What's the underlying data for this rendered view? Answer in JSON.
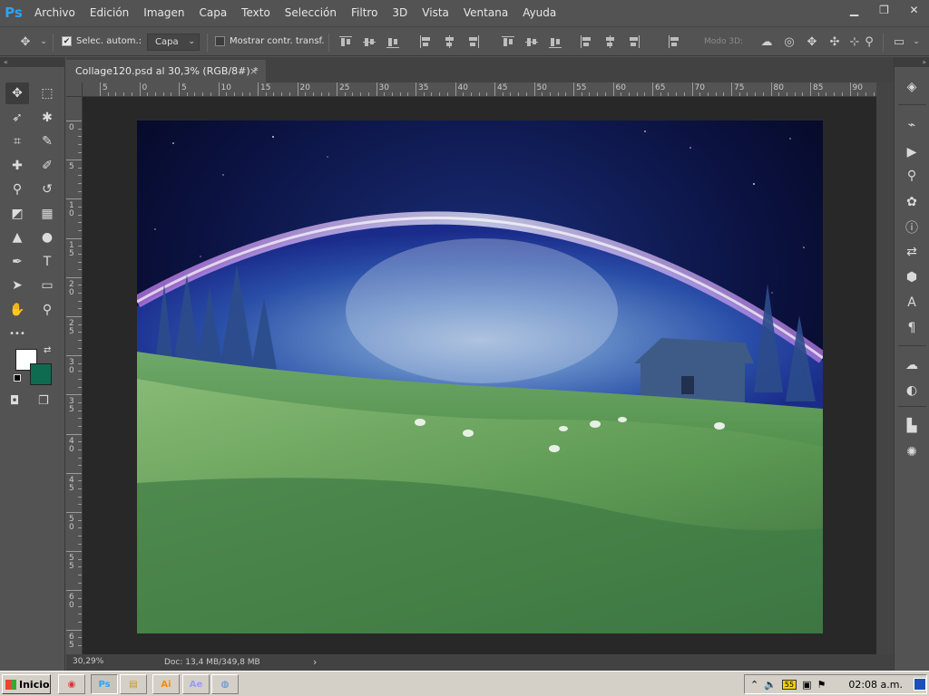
{
  "app": {
    "logo": "Ps"
  },
  "menu": [
    "Archivo",
    "Edición",
    "Imagen",
    "Capa",
    "Texto",
    "Selección",
    "Filtro",
    "3D",
    "Vista",
    "Ventana",
    "Ayuda"
  ],
  "window_controls": {
    "minimize": "▁",
    "restore": "❐",
    "close": "✕"
  },
  "options": {
    "auto_select_label": "Selec. autom.:",
    "auto_select_checked": true,
    "layer_select_value": "Capa",
    "show_transform_label": "Mostrar contr. transf.",
    "show_transform_checked": false,
    "mode3d_label": "Modo 3D:"
  },
  "document": {
    "tab_title": "Collage120.psd al 30,3% (RGB/8#) *",
    "close_glyph": "×",
    "zoom": "30,29%",
    "doc_info": "Doc: 13,4 MB/349,8 MB"
  },
  "ruler": {
    "top_labels": [
      "5",
      "0",
      "5",
      "10",
      "15",
      "20",
      "25",
      "30",
      "35",
      "40",
      "45",
      "50",
      "55",
      "60",
      "65",
      "70",
      "75",
      "80",
      "85",
      "90"
    ],
    "left_labels": [
      "0",
      "5",
      "10",
      "15",
      "20",
      "25",
      "30",
      "35",
      "40",
      "45",
      "50",
      "55",
      "60",
      "65"
    ]
  },
  "toolbar": {
    "header": "«",
    "tools": [
      {
        "name": "move-tool",
        "glyph": "✥"
      },
      {
        "name": "marquee-tool",
        "glyph": "⬚"
      },
      {
        "name": "lasso-tool",
        "glyph": "➶"
      },
      {
        "name": "magic-wand-tool",
        "glyph": "✱"
      },
      {
        "name": "crop-tool",
        "glyph": "⌗"
      },
      {
        "name": "eyedropper-tool",
        "glyph": "✎"
      },
      {
        "name": "healing-brush-tool",
        "glyph": "✚"
      },
      {
        "name": "brush-tool",
        "glyph": "✐"
      },
      {
        "name": "clone-stamp-tool",
        "glyph": "⚲"
      },
      {
        "name": "history-brush-tool",
        "glyph": "↺"
      },
      {
        "name": "eraser-tool",
        "glyph": "◩"
      },
      {
        "name": "gradient-tool",
        "glyph": "▦"
      },
      {
        "name": "blur-tool",
        "glyph": "▲"
      },
      {
        "name": "dodge-tool",
        "glyph": "●"
      },
      {
        "name": "pen-tool",
        "glyph": "✒"
      },
      {
        "name": "type-tool",
        "glyph": "T"
      },
      {
        "name": "path-selection-tool",
        "glyph": "➤"
      },
      {
        "name": "rectangle-tool",
        "glyph": "▭"
      },
      {
        "name": "hand-tool",
        "glyph": "✋"
      },
      {
        "name": "zoom-tool",
        "glyph": "⚲"
      },
      {
        "name": "more-tools",
        "glyph": "•••"
      }
    ],
    "foreground_color": "#ffffff",
    "background_color": "#0f6b4f"
  },
  "right_panel_icons": [
    {
      "name": "layers-icon",
      "glyph": "◈"
    },
    {
      "name": "paths-icon",
      "glyph": "⌁"
    },
    {
      "name": "actions-icon",
      "glyph": "▶"
    },
    {
      "name": "clone-source-icon",
      "glyph": "⚲"
    },
    {
      "name": "color-icon",
      "glyph": "✿"
    },
    {
      "name": "info-icon",
      "glyph": "ⓘ"
    },
    {
      "name": "history-icon",
      "glyph": "⇄"
    },
    {
      "name": "3d-icon",
      "glyph": "⬢"
    },
    {
      "name": "character-icon",
      "glyph": "A"
    },
    {
      "name": "paragraph-icon",
      "glyph": "¶"
    },
    {
      "name": "libraries-icon",
      "glyph": "☁"
    },
    {
      "name": "adjustments-icon",
      "glyph": "◐"
    },
    {
      "name": "histogram-icon",
      "glyph": "▙"
    },
    {
      "name": "navigator-icon",
      "glyph": "✺"
    }
  ],
  "taskbar": {
    "start_label": "Inicio",
    "apps": [
      {
        "name": "chrome-app",
        "glyph": "◉",
        "color": "#d33"
      },
      {
        "name": "photoshop-app",
        "glyph": "Ps",
        "color": "#2fa3f7"
      },
      {
        "name": "explorer-app",
        "glyph": "▤",
        "color": "#c89a2a"
      },
      {
        "name": "illustrator-app",
        "glyph": "Ai",
        "color": "#ff8a00"
      },
      {
        "name": "after-effects-app",
        "glyph": "Ae",
        "color": "#9999ff"
      },
      {
        "name": "paint-app",
        "glyph": "◍",
        "color": "#4a8bd6"
      }
    ],
    "clock": "02:08 a.m."
  }
}
